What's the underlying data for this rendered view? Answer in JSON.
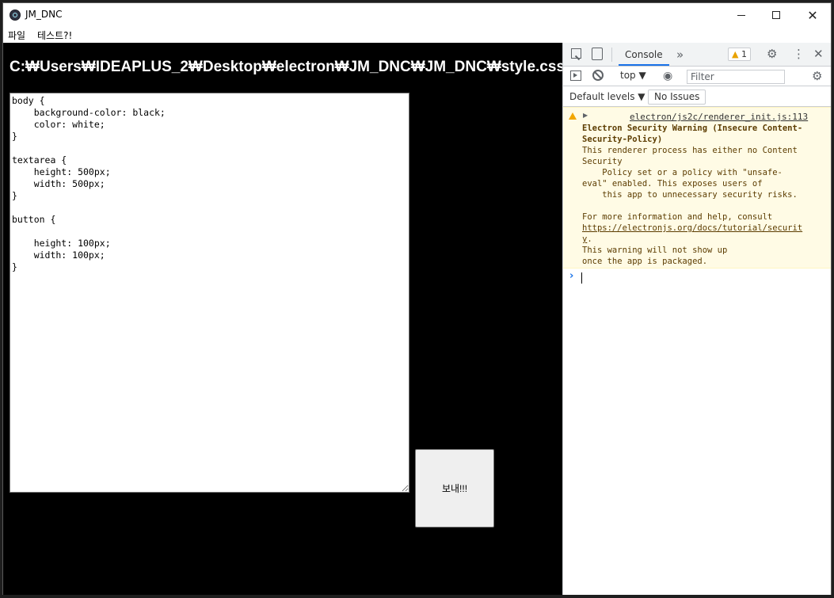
{
  "window": {
    "title": "JM_DNC",
    "minimize": "—",
    "maximize": "☐",
    "close": "✕"
  },
  "menubar": {
    "items": [
      "파일",
      "테스트?!"
    ]
  },
  "main": {
    "path_heading": "C:₩Users₩IDEAPLUS_2₩Desktop₩electron₩JM_DNC₩JM_DNC₩style.css",
    "editor_value": "body {\n    background-color: black;\n    color: white;\n}\n\ntextarea {\n    height: 500px;\n    width: 500px;\n}\n\nbutton {\n\n    height: 100px;\n    width: 100px;\n}",
    "send_button": "보내!!!"
  },
  "devtools": {
    "tabs": [
      "Console"
    ],
    "more_tabs": "»",
    "warning_count": "1",
    "context": "top ▼",
    "filter_placeholder": "Filter",
    "levels": "Default levels ▼",
    "issues": "No Issues",
    "icons": [
      "inspect-icon",
      "device-toggle-icon",
      "gear-icon",
      "kebab-icon",
      "close-icon",
      "sidebar-icon",
      "clear-icon",
      "eye-icon"
    ],
    "message": {
      "level": "warning",
      "source": "electron/js2c/renderer_init.js:113",
      "title": "Electron Security Warning (Insecure Content-\nSecurity-Policy)",
      "body": "This renderer process has either no Content\nSecurity\n    Policy set or a policy with \"unsafe-\neval\" enabled. This exposes users of\n    this app to unnecessary security risks.\n\nFor more information and help, consult",
      "link": "https://electronjs.org/docs/tutorial/securit\ny",
      "tail": ".\nThis warning will not show up\nonce the app is packaged."
    },
    "prompt": "›"
  },
  "colors": {
    "content_bg": "#000000",
    "warning_bg": "#fffbe5",
    "warning_text": "#5c3c00",
    "accent": "#1a73e8"
  }
}
